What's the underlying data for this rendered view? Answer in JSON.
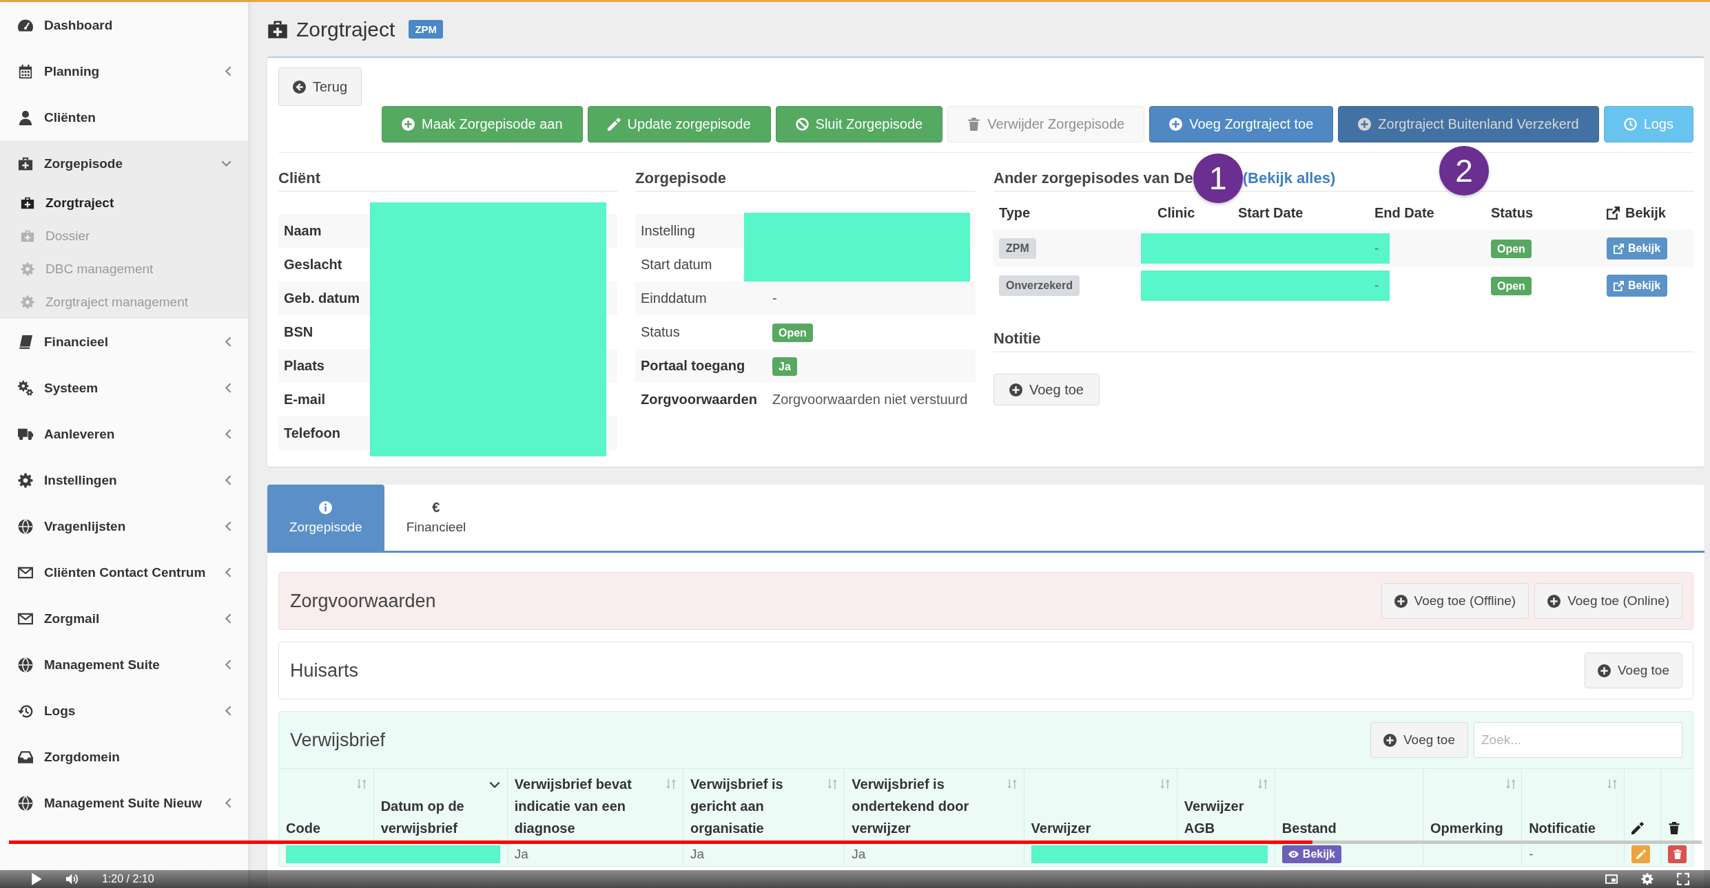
{
  "page_header": {
    "title": "Zorgtraject",
    "badge": "ZPM"
  },
  "sidebar": {
    "items": [
      {
        "label": "Dashboard",
        "kind": "link",
        "expanded": false
      },
      {
        "label": "Planning",
        "kind": "menu",
        "expanded": false
      },
      {
        "label": "Cliënten",
        "kind": "link",
        "expanded": false
      },
      {
        "label": "Zorgepisode",
        "kind": "menu",
        "expanded": true,
        "children": [
          {
            "label": "Zorgtraject",
            "selected": true
          },
          {
            "label": "Dossier",
            "selected": false
          },
          {
            "label": "DBC management",
            "selected": false
          },
          {
            "label": "Zorgtraject management",
            "selected": false
          }
        ]
      },
      {
        "label": "Financieel",
        "kind": "menu",
        "expanded": false
      },
      {
        "label": "Systeem",
        "kind": "menu",
        "expanded": false
      },
      {
        "label": "Aanleveren",
        "kind": "menu",
        "expanded": false
      },
      {
        "label": "Instellingen",
        "kind": "menu",
        "expanded": false
      },
      {
        "label": "Vragenlijsten",
        "kind": "menu",
        "expanded": false
      },
      {
        "label": "Cliënten Contact Centrum",
        "kind": "menu",
        "expanded": false
      },
      {
        "label": "Zorgmail",
        "kind": "menu",
        "expanded": false
      },
      {
        "label": "Management Suite",
        "kind": "menu",
        "expanded": false
      },
      {
        "label": "Logs",
        "kind": "menu",
        "expanded": false
      },
      {
        "label": "Zorgdomein",
        "kind": "link",
        "expanded": false
      },
      {
        "label": "Management Suite Nieuw",
        "kind": "menu",
        "expanded": false
      }
    ]
  },
  "episode_panel": {
    "back_button": "Terug",
    "actions": [
      {
        "label": "Maak Zorgepisode aan",
        "kind": "success",
        "disabled": false,
        "hovered": false
      },
      {
        "label": "Update zorgepisode",
        "kind": "success",
        "disabled": false,
        "hovered": false
      },
      {
        "label": "Sluit Zorgepisode",
        "kind": "success",
        "disabled": false,
        "hovered": false
      },
      {
        "label": "Verwijder Zorgepisode",
        "kind": "default",
        "disabled": true,
        "hovered": false
      },
      {
        "label": "Voeg Zorgtraject toe",
        "kind": "primary",
        "disabled": false,
        "hovered": false
      },
      {
        "label": "Zorgtraject Buitenland Verzekerd",
        "kind": "primary",
        "disabled": false,
        "hovered": true
      },
      {
        "label": "Logs",
        "kind": "info",
        "disabled": false,
        "hovered": false
      }
    ],
    "client": {
      "title": "Cliënt",
      "rows": [
        {
          "label": "Naam",
          "bold": true,
          "redacted": true
        },
        {
          "label": "Geslacht",
          "bold": true,
          "redacted": true
        },
        {
          "label": "Geb. datum",
          "bold": true,
          "redacted": true
        },
        {
          "label": "BSN",
          "bold": true,
          "redacted": true
        },
        {
          "label": "Plaats",
          "bold": true,
          "redacted": true
        },
        {
          "label": "E-mail",
          "bold": true,
          "redacted": true
        },
        {
          "label": "Telefoon",
          "bold": true,
          "redacted": true
        }
      ]
    },
    "episode": {
      "title": "Zorgepisode",
      "rows": [
        {
          "label": "Instelling",
          "bold": false,
          "redacted": true
        },
        {
          "label": "Start datum",
          "bold": false,
          "redacted": true
        },
        {
          "label": "Einddatum",
          "bold": false,
          "redacted": false,
          "value": "-"
        },
        {
          "label": "Status",
          "bold": false,
          "redacted": false,
          "badge": "Open"
        },
        {
          "label": "Portaal toegang",
          "bold": true,
          "redacted": false,
          "badge": "Ja"
        },
        {
          "label": "Zorgvoorwaarden",
          "bold": true,
          "redacted": false,
          "value": "Zorgvoorwaarden niet verstuurd"
        }
      ]
    },
    "other_episodes": {
      "title": "Ander zorgepisodes van De",
      "link": "(Bekijk alles)",
      "columns": [
        {
          "kind": "text",
          "label": "Type"
        },
        {
          "kind": "text",
          "label": "Clinic"
        },
        {
          "kind": "text",
          "label": "Start Date"
        },
        {
          "kind": "text",
          "label": "End Date"
        },
        {
          "kind": "text",
          "label": "Status"
        },
        {
          "kind": "link",
          "label": "Bekijk"
        }
      ],
      "rows": [
        {
          "type": "ZPM",
          "redacted": true,
          "end_date": "-",
          "status": "Open",
          "action": "Bekijk"
        },
        {
          "type": "Onverzekerd",
          "redacted": true,
          "end_date": "-",
          "status": "Open",
          "action": "Bekijk"
        }
      ]
    },
    "note": {
      "title": "Notitie",
      "add_button": "Voeg toe"
    }
  },
  "annotations": [
    {
      "text": "1"
    },
    {
      "text": "2"
    }
  ],
  "tabs": [
    {
      "label": "Zorgepisode",
      "selected": true
    },
    {
      "label": "Financieel",
      "symbol": "€",
      "selected": false
    }
  ],
  "sections": [
    {
      "kind": "warning",
      "title": "Zorgvoorwaarden",
      "buttons": [
        "Voeg toe (Offline)",
        "Voeg toe (Online)"
      ]
    },
    {
      "kind": "plain",
      "title": "Huisarts",
      "buttons": [
        "Voeg toe"
      ]
    },
    {
      "kind": "success",
      "title": "Verwijsbrief",
      "buttons": [
        "Voeg toe"
      ],
      "search": {
        "placeholder": "Zoek..."
      },
      "table": {
        "columns": [
          {
            "kind": "text",
            "label": "Code",
            "sortable": true,
            "sorted": false
          },
          {
            "kind": "text",
            "label": "Datum op de verwijsbrief",
            "sortable": true,
            "sorted": true
          },
          {
            "kind": "text",
            "label": "Verwijsbrief bevat indicatie van een diagnose",
            "sortable": true,
            "sorted": false
          },
          {
            "kind": "text",
            "label": "Verwijsbrief is gericht aan organisatie",
            "sortable": true,
            "sorted": false
          },
          {
            "kind": "text",
            "label": "Verwijsbrief is ondertekend door verwijzer",
            "sortable": true,
            "sorted": false
          },
          {
            "kind": "text",
            "label": "Verwijzer",
            "sortable": true,
            "sorted": false
          },
          {
            "kind": "text",
            "label": "Verwijzer AGB",
            "sortable": true,
            "sorted": false
          },
          {
            "kind": "text",
            "label": "Bestand",
            "sortable": false,
            "sorted": false
          },
          {
            "kind": "text",
            "label": "Opmerking",
            "sortable": true,
            "sorted": false
          },
          {
            "kind": "text",
            "label": "Notificatie",
            "sortable": true,
            "sorted": false
          },
          {
            "kind": "edit",
            "sortable": false,
            "sorted": false
          },
          {
            "kind": "delete",
            "sortable": false,
            "sorted": false
          }
        ],
        "rows": [
          {
            "cells": [
              {
                "kind": "redacted"
              },
              {
                "kind": "redacted"
              },
              {
                "kind": "text",
                "text": "Ja"
              },
              {
                "kind": "text",
                "text": "Ja"
              },
              {
                "kind": "text",
                "text": "Ja"
              },
              {
                "kind": "redacted"
              },
              {
                "kind": "redacted"
              },
              {
                "kind": "file",
                "text": "Bekijk"
              },
              {
                "kind": "blank"
              },
              {
                "kind": "text",
                "text": "-"
              },
              {
                "kind": "edit"
              },
              {
                "kind": "delete"
              }
            ]
          }
        ]
      }
    }
  ],
  "video_player": {
    "level": 0.77,
    "time": "1:20 / 2:10"
  }
}
